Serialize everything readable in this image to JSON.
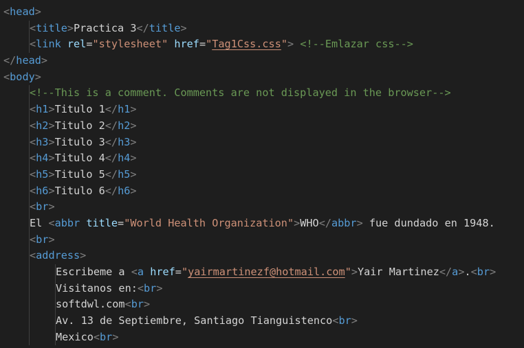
{
  "lines": [
    {
      "indent": 0,
      "guides": [],
      "tokens": [
        [
          "bracket",
          "<"
        ],
        [
          "tag",
          "head"
        ],
        [
          "bracket",
          ">"
        ]
      ]
    },
    {
      "indent": 1,
      "guides": [
        1
      ],
      "tokens": [
        [
          "bracket",
          "<"
        ],
        [
          "tag",
          "title"
        ],
        [
          "bracket",
          ">"
        ],
        [
          "text",
          "Practica 3"
        ],
        [
          "bracket",
          "</"
        ],
        [
          "tag",
          "title"
        ],
        [
          "bracket",
          ">"
        ]
      ]
    },
    {
      "indent": 1,
      "guides": [
        1
      ],
      "tokens": [
        [
          "bracket",
          "<"
        ],
        [
          "tag",
          "link"
        ],
        [
          "text",
          " "
        ],
        [
          "attr",
          "rel"
        ],
        [
          "eq",
          "="
        ],
        [
          "str",
          "\"stylesheet\""
        ],
        [
          "text",
          " "
        ],
        [
          "attr",
          "href"
        ],
        [
          "eq",
          "="
        ],
        [
          "str",
          "\""
        ],
        [
          "strlink",
          "Tag1Css.css"
        ],
        [
          "str",
          "\""
        ],
        [
          "bracket",
          ">"
        ],
        [
          "text",
          " "
        ],
        [
          "comment",
          "<!--Emlazar css-->"
        ]
      ]
    },
    {
      "indent": 0,
      "guides": [],
      "tokens": [
        [
          "bracket",
          "</"
        ],
        [
          "tag",
          "head"
        ],
        [
          "bracket",
          ">"
        ]
      ]
    },
    {
      "indent": 0,
      "guides": [],
      "tokens": [
        [
          "bracket",
          "<"
        ],
        [
          "tag",
          "body"
        ],
        [
          "bracket",
          ">"
        ]
      ]
    },
    {
      "indent": 1,
      "guides": [
        1
      ],
      "tokens": [
        [
          "comment",
          "<!--This is a comment. Comments are not displayed in the browser-->"
        ]
      ]
    },
    {
      "indent": 1,
      "guides": [
        1
      ],
      "tokens": [
        [
          "bracket",
          "<"
        ],
        [
          "tag",
          "h1"
        ],
        [
          "bracket",
          ">"
        ],
        [
          "text",
          "Titulo 1"
        ],
        [
          "bracket",
          "</"
        ],
        [
          "tag",
          "h1"
        ],
        [
          "bracket",
          ">"
        ]
      ]
    },
    {
      "indent": 1,
      "guides": [
        1
      ],
      "tokens": [
        [
          "bracket",
          "<"
        ],
        [
          "tag",
          "h2"
        ],
        [
          "bracket",
          ">"
        ],
        [
          "text",
          "Titulo 2"
        ],
        [
          "bracket",
          "</"
        ],
        [
          "tag",
          "h2"
        ],
        [
          "bracket",
          ">"
        ]
      ]
    },
    {
      "indent": 1,
      "guides": [
        1
      ],
      "tokens": [
        [
          "bracket",
          "<"
        ],
        [
          "tag",
          "h3"
        ],
        [
          "bracket",
          ">"
        ],
        [
          "text",
          "Titulo 3"
        ],
        [
          "bracket",
          "</"
        ],
        [
          "tag",
          "h3"
        ],
        [
          "bracket",
          ">"
        ]
      ]
    },
    {
      "indent": 1,
      "guides": [
        1
      ],
      "tokens": [
        [
          "bracket",
          "<"
        ],
        [
          "tag",
          "h4"
        ],
        [
          "bracket",
          ">"
        ],
        [
          "text",
          "Titulo 4"
        ],
        [
          "bracket",
          "</"
        ],
        [
          "tag",
          "h4"
        ],
        [
          "bracket",
          ">"
        ]
      ]
    },
    {
      "indent": 1,
      "guides": [
        1
      ],
      "tokens": [
        [
          "bracket",
          "<"
        ],
        [
          "tag",
          "h5"
        ],
        [
          "bracket",
          ">"
        ],
        [
          "text",
          "Titulo 5"
        ],
        [
          "bracket",
          "</"
        ],
        [
          "tag",
          "h5"
        ],
        [
          "bracket",
          ">"
        ]
      ]
    },
    {
      "indent": 1,
      "guides": [
        1
      ],
      "tokens": [
        [
          "bracket",
          "<"
        ],
        [
          "tag",
          "h6"
        ],
        [
          "bracket",
          ">"
        ],
        [
          "text",
          "Titulo 6"
        ],
        [
          "bracket",
          "</"
        ],
        [
          "tag",
          "h6"
        ],
        [
          "bracket",
          ">"
        ]
      ]
    },
    {
      "indent": 1,
      "guides": [
        1
      ],
      "tokens": [
        [
          "bracket",
          "<"
        ],
        [
          "tag",
          "br"
        ],
        [
          "bracket",
          ">"
        ]
      ]
    },
    {
      "indent": 1,
      "guides": [
        1
      ],
      "tokens": [
        [
          "text",
          "El "
        ],
        [
          "bracket",
          "<"
        ],
        [
          "tag",
          "abbr"
        ],
        [
          "text",
          " "
        ],
        [
          "attr",
          "title"
        ],
        [
          "eq",
          "="
        ],
        [
          "str",
          "\"World Health Organization\""
        ],
        [
          "bracket",
          ">"
        ],
        [
          "text",
          "WHO"
        ],
        [
          "bracket",
          "</"
        ],
        [
          "tag",
          "abbr"
        ],
        [
          "bracket",
          ">"
        ],
        [
          "text",
          " fue dundado en 1948."
        ]
      ]
    },
    {
      "indent": 1,
      "guides": [
        1
      ],
      "tokens": [
        [
          "bracket",
          "<"
        ],
        [
          "tag",
          "br"
        ],
        [
          "bracket",
          ">"
        ]
      ]
    },
    {
      "indent": 1,
      "guides": [
        1
      ],
      "tokens": [
        [
          "bracket",
          "<"
        ],
        [
          "tag",
          "address"
        ],
        [
          "bracket",
          ">"
        ]
      ]
    },
    {
      "indent": 2,
      "guides": [
        1,
        2
      ],
      "tokens": [
        [
          "text",
          "Escribeme a "
        ],
        [
          "bracket",
          "<"
        ],
        [
          "tag",
          "a"
        ],
        [
          "text",
          " "
        ],
        [
          "attr",
          "href"
        ],
        [
          "eq",
          "="
        ],
        [
          "str",
          "\""
        ],
        [
          "strlink",
          "yairmartinezf@hotmail.com"
        ],
        [
          "str",
          "\""
        ],
        [
          "bracket",
          ">"
        ],
        [
          "text",
          "Yair Martinez"
        ],
        [
          "bracket",
          "</"
        ],
        [
          "tag",
          "a"
        ],
        [
          "bracket",
          ">"
        ],
        [
          "text",
          "."
        ],
        [
          "bracket",
          "<"
        ],
        [
          "tag",
          "br"
        ],
        [
          "bracket",
          ">"
        ]
      ]
    },
    {
      "indent": 2,
      "guides": [
        1,
        2
      ],
      "tokens": [
        [
          "text",
          "Visitanos en:"
        ],
        [
          "bracket",
          "<"
        ],
        [
          "tag",
          "br"
        ],
        [
          "bracket",
          ">"
        ]
      ]
    },
    {
      "indent": 2,
      "guides": [
        1,
        2
      ],
      "tokens": [
        [
          "text",
          "softdwl.com"
        ],
        [
          "bracket",
          "<"
        ],
        [
          "tag",
          "br"
        ],
        [
          "bracket",
          ">"
        ]
      ]
    },
    {
      "indent": 2,
      "guides": [
        1,
        2
      ],
      "tokens": [
        [
          "text",
          "Av. 13 de Septiembre, Santiago Tianguistenco"
        ],
        [
          "bracket",
          "<"
        ],
        [
          "tag",
          "br"
        ],
        [
          "bracket",
          ">"
        ]
      ]
    },
    {
      "indent": 2,
      "guides": [
        1,
        2
      ],
      "tokens": [
        [
          "text",
          "Mexico"
        ],
        [
          "bracket",
          "<"
        ],
        [
          "tag",
          "br"
        ],
        [
          "bracket",
          ">"
        ]
      ]
    }
  ],
  "colors": {
    "background": "#1e1e1e",
    "tag": "#569cd6",
    "attribute": "#9cdcfe",
    "string": "#ce9178",
    "comment": "#6a9955",
    "text": "#d4d4d4",
    "bracket": "#808080"
  }
}
